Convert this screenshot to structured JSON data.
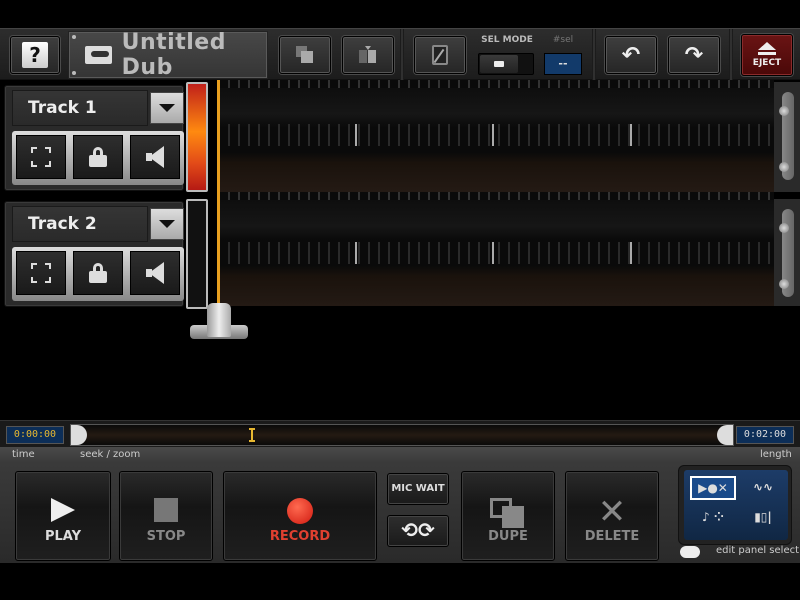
{
  "toolbar": {
    "help_label": "?",
    "title": "Untitled Dub",
    "sel_mode_label": "SEL MODE",
    "num_sel_label": "#sel",
    "num_sel_value": "--",
    "eject_label": "EJECT",
    "icons": {
      "help": "question-icon",
      "cassette": "cassette-icon",
      "copy": "copy-icon",
      "paste": "paste-icon",
      "split": "split-icon",
      "undo": "undo-icon",
      "redo": "redo-icon",
      "eject": "eject-icon"
    }
  },
  "tracks": [
    {
      "name": "Track 1",
      "level_active": true,
      "buttons": [
        "fit-icon",
        "lock-icon",
        "speaker-icon"
      ]
    },
    {
      "name": "Track 2",
      "level_active": false,
      "buttons": [
        "fit-icon",
        "lock-icon",
        "speaker-icon"
      ]
    }
  ],
  "timeline": {
    "current_time": "0:00:00",
    "length": "0:02:00",
    "time_label": "time",
    "seek_label": "seek / zoom",
    "length_label": "length"
  },
  "transport": {
    "play_label": "PLAY",
    "stop_label": "STOP",
    "record_label": "RECORD",
    "mic_wait_label": "MIC WAIT",
    "loop_glyph": "⟲⟳",
    "dupe_label": "DUPE",
    "delete_label": "DELETE",
    "delete_glyph": "✕"
  },
  "edit_panel": {
    "label": "edit panel select",
    "items": [
      "▶●✕",
      "∿∿",
      "♪ ⁘",
      "▮▯|"
    ]
  },
  "colors": {
    "accent_orange": "#e8a020",
    "record_red": "#d01a10",
    "eject_red": "#6a1414",
    "display_blue": "#0c2e58"
  }
}
